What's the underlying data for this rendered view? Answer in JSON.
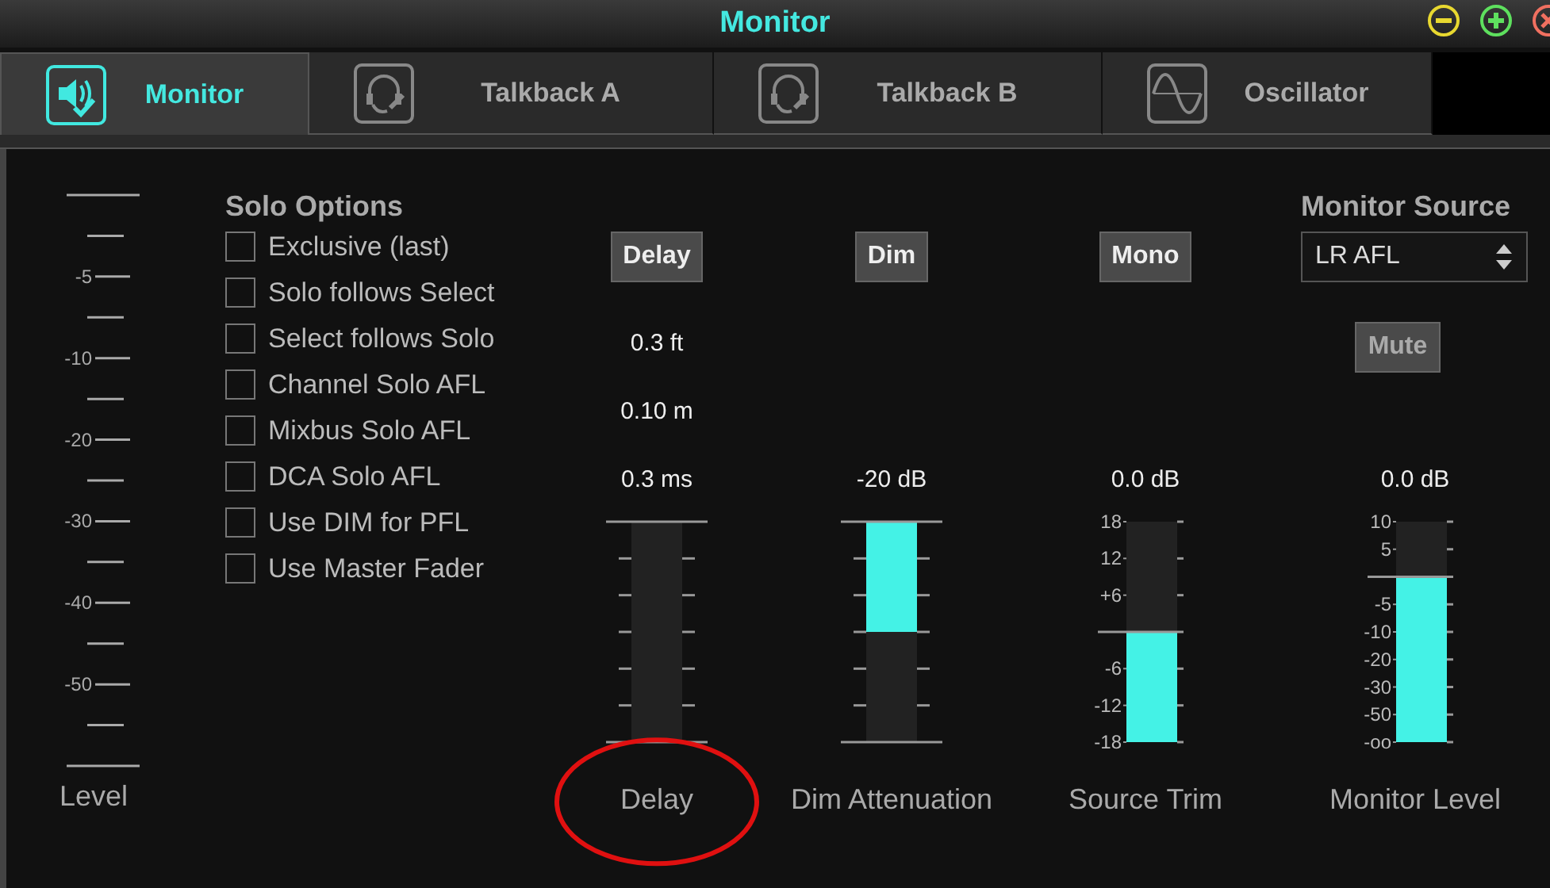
{
  "window": {
    "title": "Monitor"
  },
  "window_controls": [
    {
      "kind": "minimize"
    },
    {
      "kind": "maximize"
    },
    {
      "kind": "close"
    }
  ],
  "tabs": [
    {
      "label": "Monitor",
      "kind": "speaker",
      "selected": true
    },
    {
      "label": "Talkback A",
      "kind": "talkback",
      "selected": false
    },
    {
      "label": "Talkback B",
      "kind": "talkback",
      "selected": false
    },
    {
      "label": "Oscillator",
      "kind": "wave",
      "selected": false
    }
  ],
  "level_meter": {
    "label": "Level",
    "ticks": [
      {
        "kind": "end"
      },
      {
        "kind": "minor"
      },
      {
        "kind": "label",
        "label": "-5"
      },
      {
        "kind": "minor"
      },
      {
        "kind": "label",
        "label": "-10"
      },
      {
        "kind": "minor"
      },
      {
        "kind": "label",
        "label": "-20"
      },
      {
        "kind": "minor"
      },
      {
        "kind": "label",
        "label": "-30"
      },
      {
        "kind": "minor"
      },
      {
        "kind": "label",
        "label": "-40"
      },
      {
        "kind": "minor"
      },
      {
        "kind": "label",
        "label": "-50"
      },
      {
        "kind": "minor"
      },
      {
        "kind": "end"
      }
    ]
  },
  "solo_options": {
    "title": "Solo Options",
    "items": [
      {
        "label": "Exclusive (last)",
        "checked": false
      },
      {
        "label": "Solo follows Select",
        "checked": false
      },
      {
        "label": "Select follows Solo",
        "checked": false
      },
      {
        "label": "Channel Solo AFL",
        "checked": false
      },
      {
        "label": "Mixbus Solo AFL",
        "checked": false
      },
      {
        "label": "DCA Solo AFL",
        "checked": false
      },
      {
        "label": "Use DIM for PFL",
        "checked": false
      },
      {
        "label": "Use Master Fader",
        "checked": false
      }
    ]
  },
  "channels": [
    {
      "button": {
        "label": "Delay",
        "disabled": false
      },
      "readouts": [
        "0.3 ft",
        "0.10 m",
        "0.3 ms"
      ],
      "label": "Delay",
      "highlight": true
    },
    {
      "button": {
        "label": "Dim",
        "disabled": false
      },
      "readouts": [
        "-20 dB"
      ],
      "fader": {
        "kind": "attenuator",
        "level": 0.5
      },
      "label": "Dim Attenuation"
    },
    {
      "button": {
        "label": "Mono",
        "disabled": false
      },
      "readouts": [
        "0.0 dB"
      ],
      "fader": {
        "kind": "level",
        "level": 0.5,
        "scale": [
          {
            "kind": "label",
            "label": "18"
          },
          {
            "kind": "label",
            "label": "12"
          },
          {
            "kind": "label",
            "label": "+6"
          },
          {
            "kind": "zero"
          },
          {
            "kind": "label",
            "label": "-6"
          },
          {
            "kind": "label",
            "label": "-12"
          },
          {
            "kind": "label",
            "label": "-18"
          }
        ]
      },
      "label": "Source Trim"
    },
    {
      "source": {
        "title": "Monitor Source",
        "value": "LR AFL"
      },
      "button": {
        "label": "Mute",
        "disabled": true
      },
      "readouts": [
        "0.0 dB"
      ],
      "fader": {
        "kind": "level",
        "level": 0.75,
        "scale": [
          {
            "kind": "label",
            "label": "10"
          },
          {
            "kind": "label",
            "label": "5"
          },
          {
            "kind": "zero"
          },
          {
            "kind": "label",
            "label": "-5"
          },
          {
            "kind": "label",
            "label": "-10"
          },
          {
            "kind": "label",
            "label": "-20"
          },
          {
            "kind": "label",
            "label": "-30"
          },
          {
            "kind": "label",
            "label": "-50"
          },
          {
            "kind": "label",
            "label": "-oo"
          }
        ]
      },
      "label": "Monitor Level"
    }
  ]
}
